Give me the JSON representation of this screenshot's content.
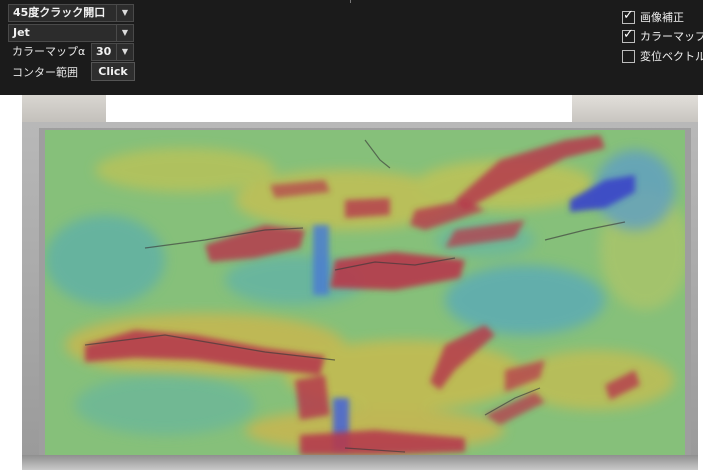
{
  "toolbar": {
    "mode_select": {
      "value": "45度クラック開口"
    },
    "colormap_select": {
      "value": "Jet"
    },
    "alpha": {
      "label": "カラーマップα",
      "value": "30"
    },
    "contour": {
      "label": "コンター範囲",
      "button_label": "Click"
    }
  },
  "options": {
    "items": [
      {
        "label": "画像補正",
        "checked": true
      },
      {
        "label": "カラーマップ表示",
        "checked": true
      },
      {
        "label": "変位ベクトル表示",
        "checked": false
      }
    ]
  },
  "viewer": {
    "colormap": "jet",
    "colors": {
      "background_field": "#7fbf77",
      "high": "#b83a4a",
      "mid": "#c8b94d",
      "low": "#4aa0b8",
      "lowest": "#3b48c8"
    }
  }
}
